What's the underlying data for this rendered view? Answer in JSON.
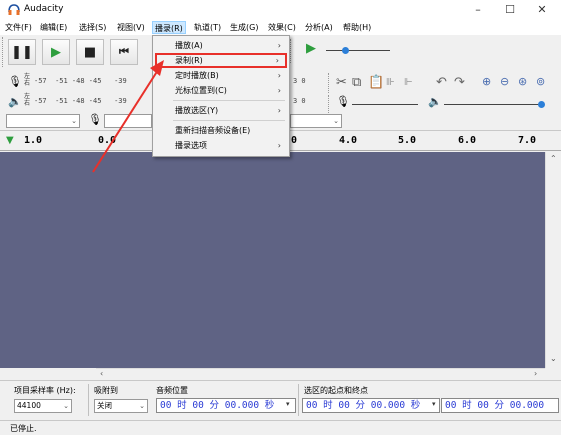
{
  "window": {
    "title": "Audacity",
    "minimize": "–",
    "maximize": "☐",
    "close": "✕"
  },
  "menubar": {
    "items": [
      {
        "label": "文件(F)"
      },
      {
        "label": "编辑(E)"
      },
      {
        "label": "选择(S)"
      },
      {
        "label": "视图(V)"
      },
      {
        "label": "播录(R)"
      },
      {
        "label": "轨道(T)"
      },
      {
        "label": "生成(G)"
      },
      {
        "label": "效果(C)"
      },
      {
        "label": "分析(A)"
      },
      {
        "label": "帮助(H)"
      }
    ]
  },
  "transport": {
    "pause": "❚❚",
    "play": "▶",
    "stop": "■",
    "skip_start": "⏮"
  },
  "meters": {
    "record_ticks": "-57  -51 -48 -45   -39",
    "record_lr": "左\n右",
    "play_ticks": "-57  -51 -48 -45   -39",
    "play_lr": "左\n右",
    "right_ticks": "3 0",
    "right_ticks2": "3 0"
  },
  "ruler": {
    "labels": [
      "1.0",
      "0.0",
      "4.0",
      "5.0",
      "6.0",
      "7.0"
    ],
    "hidden_label": "0"
  },
  "dropdown": {
    "items": [
      {
        "label": "播放(A)",
        "submenu": true
      },
      {
        "label": "录制(R)",
        "submenu": true
      },
      {
        "label": "定时播放(B)",
        "submenu": true
      },
      {
        "label": "光标位置到(C)",
        "submenu": true
      },
      {
        "label": "播放选区(Y)",
        "submenu": true
      },
      {
        "label": "重新扫描音频设备(E)",
        "submenu": false
      },
      {
        "label": "播录选项",
        "submenu": true
      }
    ]
  },
  "bottom": {
    "rate_label": "项目采样率 (Hz):",
    "rate_value": "44100",
    "snap_label": "吸附到",
    "snap_value": "关闭",
    "audio_pos_label": "音频位置",
    "audio_pos_value": "00 时 00 分 00.000 秒",
    "selection_label": "选区的起点和终点",
    "sel_start_value": "00 时 00 分 00.000 秒",
    "sel_end_value": "00 时 00 分 00.000"
  },
  "status": {
    "text": "已停止."
  },
  "colors": {
    "track_bg": "#5f6384",
    "highlight": "#e8302a",
    "play_green": "#2e9e3e",
    "time_blue": "#2a3bd4"
  }
}
